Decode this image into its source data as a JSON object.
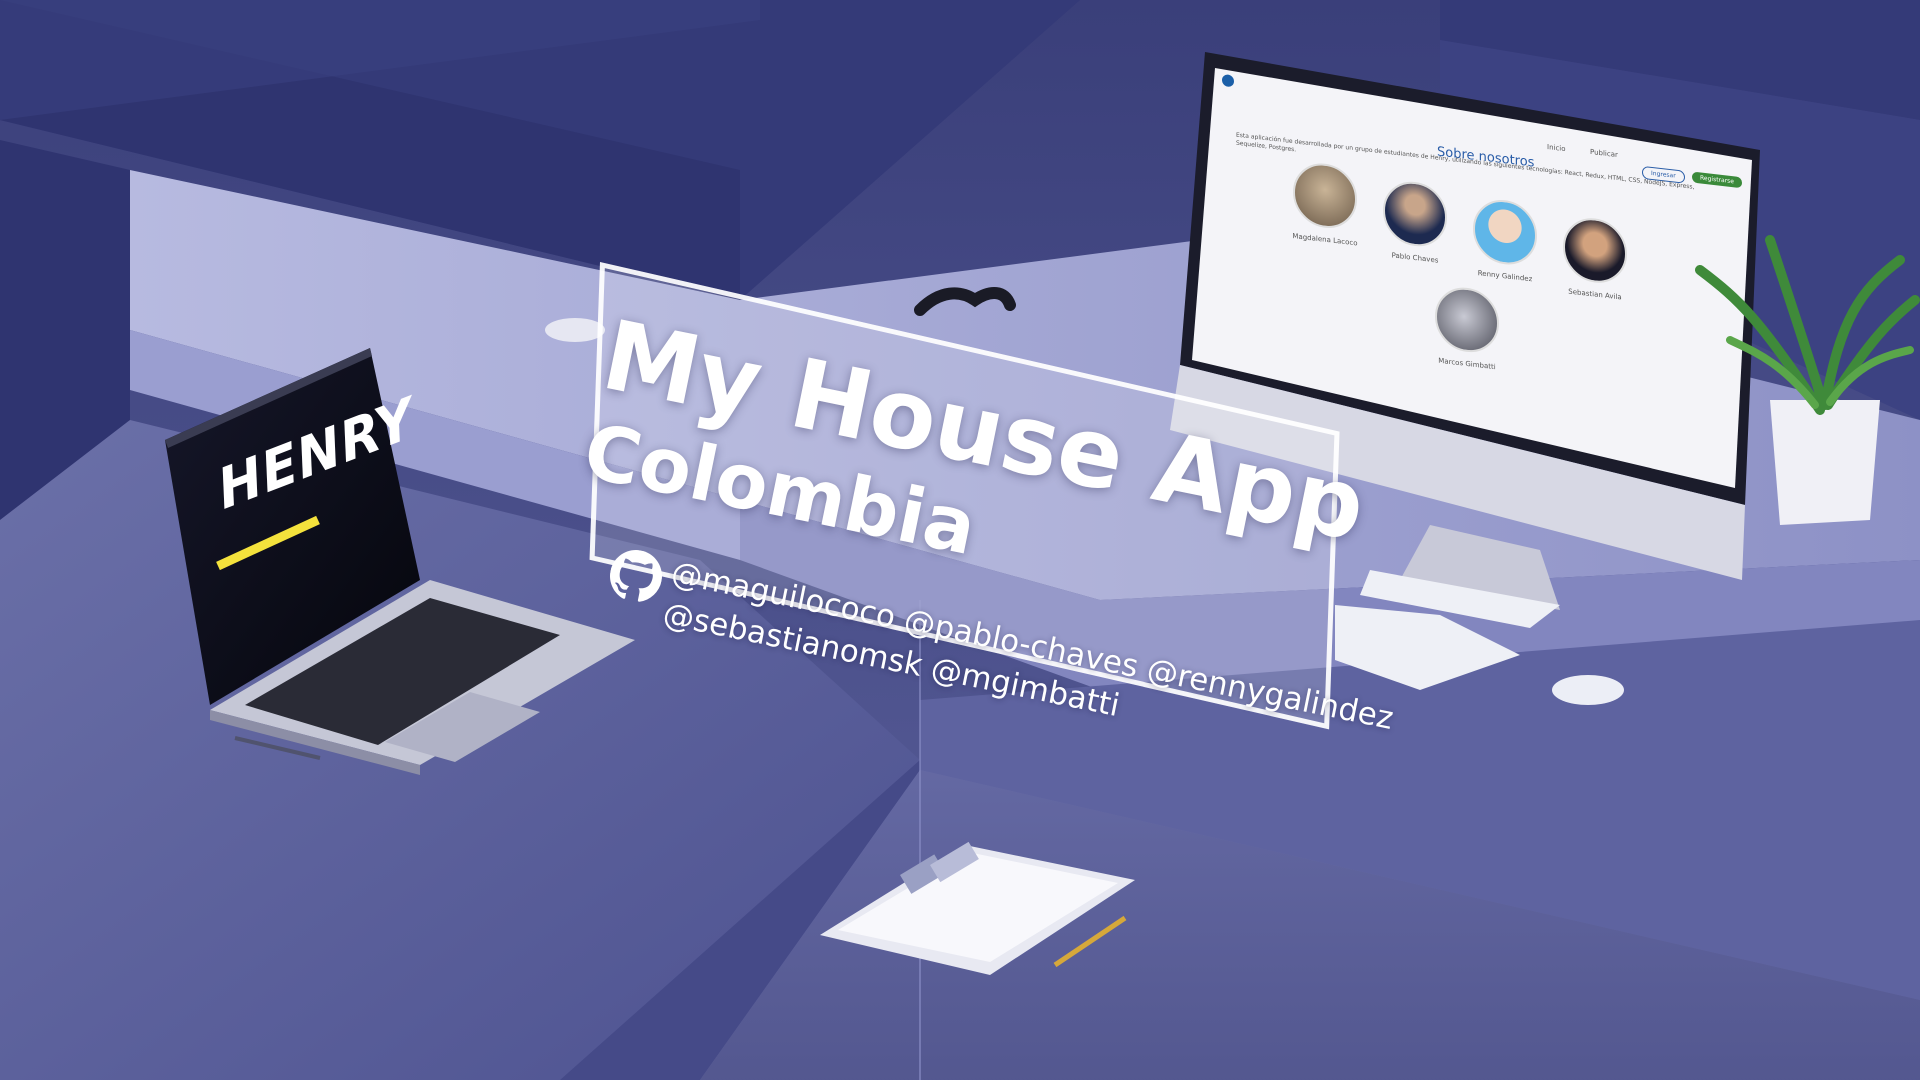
{
  "overlay": {
    "title": "My House App",
    "subtitle": "Colombia",
    "handles_line1": "@maguilococo @pablo-chaves @rennygalindez",
    "handles_line2": "@sebastianomsk @mgimbatti"
  },
  "laptop": {
    "logo_text": "HENRY"
  },
  "monitor": {
    "nav": {
      "inicio": "Inicio",
      "publicar": "Publicar",
      "ingresar": "Ingresar",
      "registrarse": "Registrarse"
    },
    "page_title": "Sobre nosotros",
    "description": "Esta aplicación fue desarrollada por un grupo de estudiantes de Henry, utilizando las siguientes tecnologías: React, Redux, HTML, CSS, NodeJS, Express, Sequelize, Postgres.",
    "members": [
      {
        "name": "Magdalena Lacoco"
      },
      {
        "name": "Pablo Chaves"
      },
      {
        "name": "Renny Galindez"
      },
      {
        "name": "Sebastian Avila"
      },
      {
        "name": "Marcos Gimbatti"
      }
    ]
  },
  "colors": {
    "background": "#4a4f8a",
    "accent_blue": "#2a5da8",
    "register_green": "#3a8a3a",
    "henry_yellow": "#f4e23c"
  },
  "icons": {
    "github": "github-icon"
  }
}
